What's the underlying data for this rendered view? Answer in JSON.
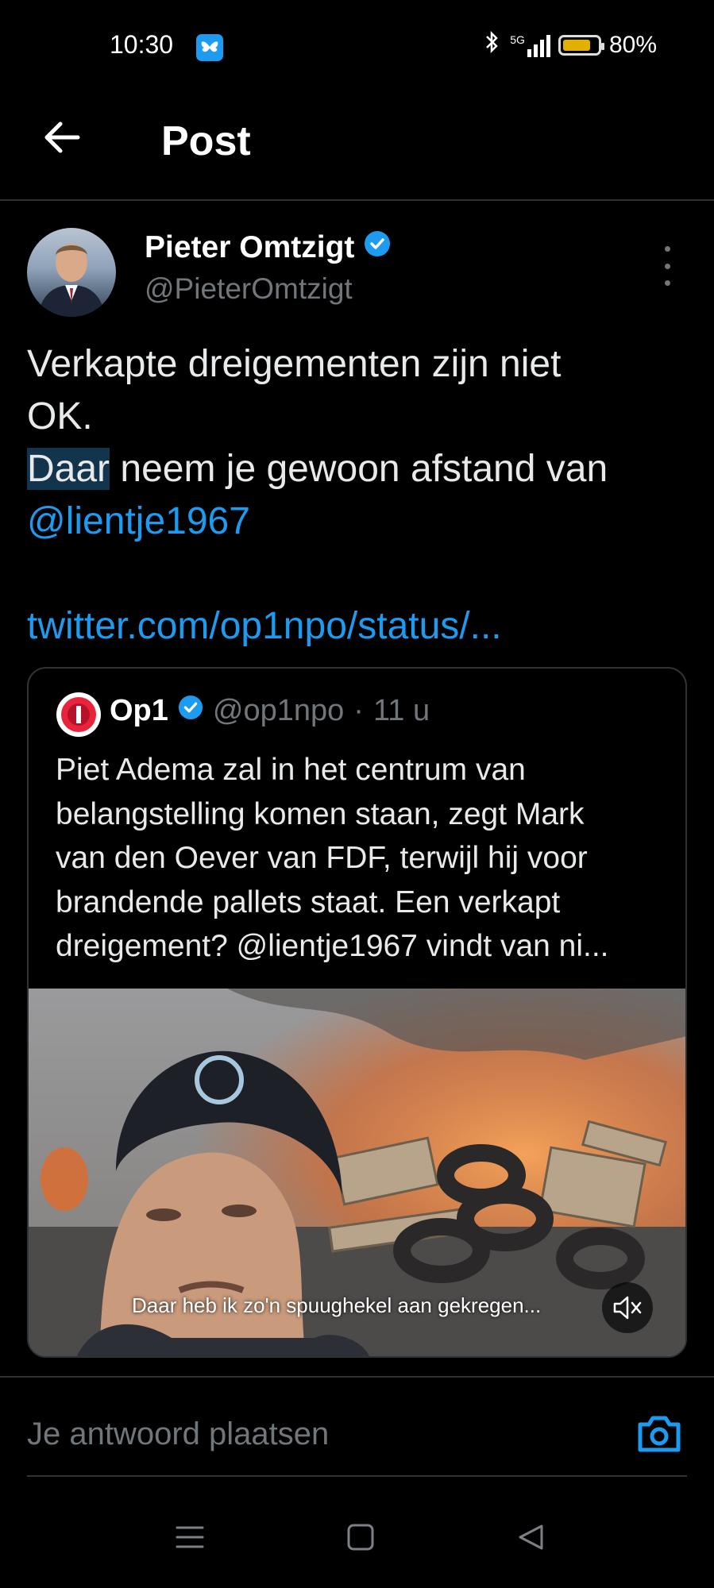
{
  "status_bar": {
    "time": "10:30",
    "battery": "80%",
    "battery_level": 0.8,
    "network": "5G",
    "app_icon": "bluesky-butterfly-icon"
  },
  "header": {
    "title": "Post"
  },
  "post": {
    "author_name": "Pieter Omtzigt",
    "author_handle": "@PieterOmtzigt",
    "text_lines": [
      "Verkapte dreigementen zijn niet",
      "OK."
    ],
    "line3_highlight": "Daar",
    "line3_rest": " neem je gewoon afstand van",
    "mention": "@lientje1967",
    "link": "twitter.com/op1npo/status/..."
  },
  "quote": {
    "name": "Op1",
    "handle": "@op1npo",
    "separator": "·",
    "time": "11 u",
    "text_lines": [
      "Piet Adema zal in het centrum van",
      "belangstelling komen staan, zegt Mark",
      "van den Oever van FDF, terwijl hij voor",
      "brandende pallets staat. Een verkapt",
      "dreigement? @lientje1967 vindt van ni..."
    ],
    "video_subtitle": "Daar heb ik zo'n spuughekel aan gekregen..."
  },
  "reply": {
    "placeholder": "Je antwoord plaatsen"
  },
  "colors": {
    "background": "#000000",
    "text": "#e7e9ea",
    "muted": "#71767b",
    "accent": "#1d9bf0",
    "divider": "#2f3336"
  }
}
